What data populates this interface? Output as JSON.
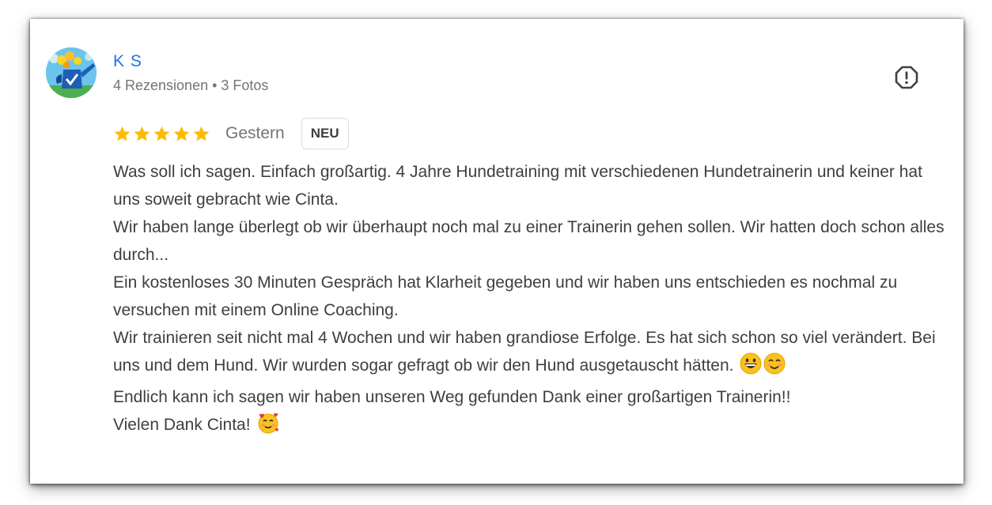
{
  "review": {
    "author": {
      "name": "K S",
      "meta": "4 Rezensionen • 3 Fotos",
      "avatar_icon": "watering-can-flowers-avatar"
    },
    "report_icon": "report-octagon-icon",
    "rating": 5,
    "max_rating": 5,
    "date": "Gestern",
    "badge": "NEU",
    "paragraphs": [
      "Was soll ich sagen. Einfach großartig. 4 Jahre Hundetraining mit verschiedenen Hundetrainerin und keiner hat uns soweit gebracht wie Cinta.",
      "Wir haben lange überlegt ob wir überhaupt noch mal zu einer Trainerin gehen sollen. Wir hatten doch schon alles durch...",
      "Ein kostenloses 30 Minuten Gespräch hat Klarheit gegeben und wir haben uns entschieden es nochmal zu versuchen mit einem Online Coaching.",
      "Wir trainieren seit nicht mal 4 Wochen und wir haben grandiose Erfolge. Es hat sich schon so viel verändert. Bei uns und dem Hund. Wir wurden sogar gefragt ob wir den Hund ausgetauscht hätten.",
      "Endlich kann ich sagen wir haben unseren Weg gefunden Dank einer großartigen Trainerin!!",
      "Vielen Dank Cinta!"
    ],
    "emojis": {
      "p4": [
        "grinning-face-icon",
        "smiling-face-icon"
      ],
      "p6": [
        "smiling-face-with-hearts-icon"
      ]
    }
  },
  "colors": {
    "name": "#1a73e8",
    "meta": "#70757a",
    "star": "#fbbc04",
    "text": "#3c4043"
  }
}
